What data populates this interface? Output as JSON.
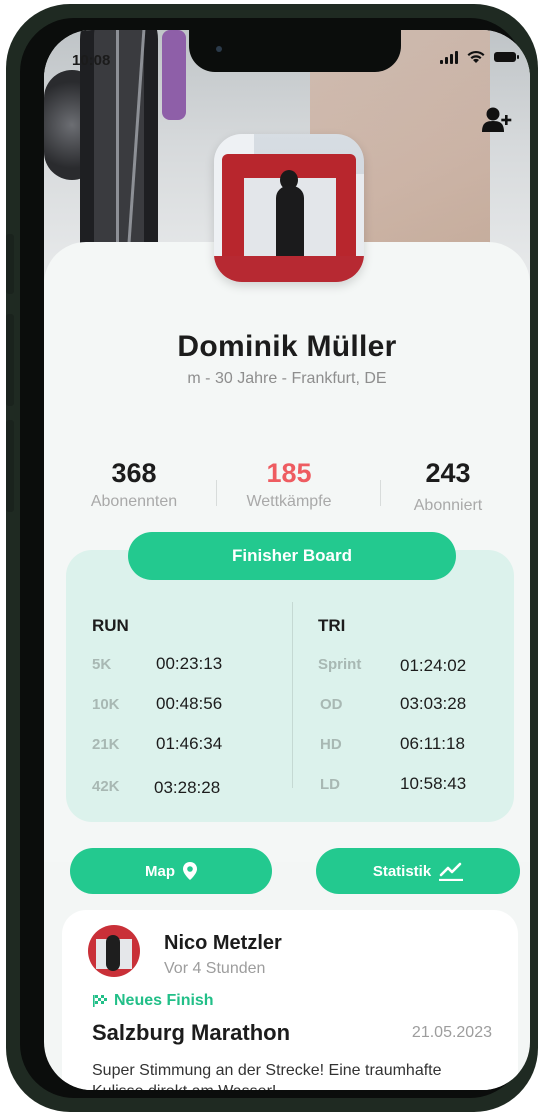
{
  "status_bar": {
    "time": "10:08"
  },
  "profile": {
    "name": "Dominik Müller",
    "meta": "m - 30 Jahre - Frankfurt, DE"
  },
  "social": {
    "icons": [
      "instagram-icon",
      "strava-icon"
    ]
  },
  "stats": [
    {
      "value": "368",
      "label": "Abonennten",
      "color": "#1c1c1c"
    },
    {
      "value": "185",
      "label": "Wettkämpfe",
      "color": "#ee5c61"
    },
    {
      "value": "243",
      "label": "Abonniert",
      "color": "#1c1c1c"
    }
  ],
  "finisher_board": {
    "button_label": "Finisher Board",
    "run": {
      "title": "RUN",
      "rows": [
        {
          "distance": "5K",
          "time": "00:23:13"
        },
        {
          "distance": "10K",
          "time": "00:48:56"
        },
        {
          "distance": "21K",
          "time": "01:46:34"
        },
        {
          "distance": "42K",
          "time": "03:28:28"
        }
      ]
    },
    "tri": {
      "title": "TRI",
      "rows": [
        {
          "distance": "Sprint",
          "time": "01:24:02"
        },
        {
          "distance": "OD",
          "time": "03:03:28"
        },
        {
          "distance": "HD",
          "time": "06:11:18"
        },
        {
          "distance": "LD",
          "time": "10:58:43"
        }
      ]
    }
  },
  "actions": {
    "map_label": "Map",
    "statistik_label": "Statistik"
  },
  "feed": {
    "author": "Nico Metzler",
    "time_ago": "Vor 4 Stunden",
    "tag": "Neues Finish",
    "event": "Salzburg Marathon",
    "date": "21.05.2023",
    "text": "Super Stimmung an der Strecke! Eine traumhafte Kulisse direkt am Wasser!"
  },
  "colors": {
    "accent": "#23c98f",
    "highlight": "#ee5c61",
    "board_bg": "#dcf2ec"
  }
}
